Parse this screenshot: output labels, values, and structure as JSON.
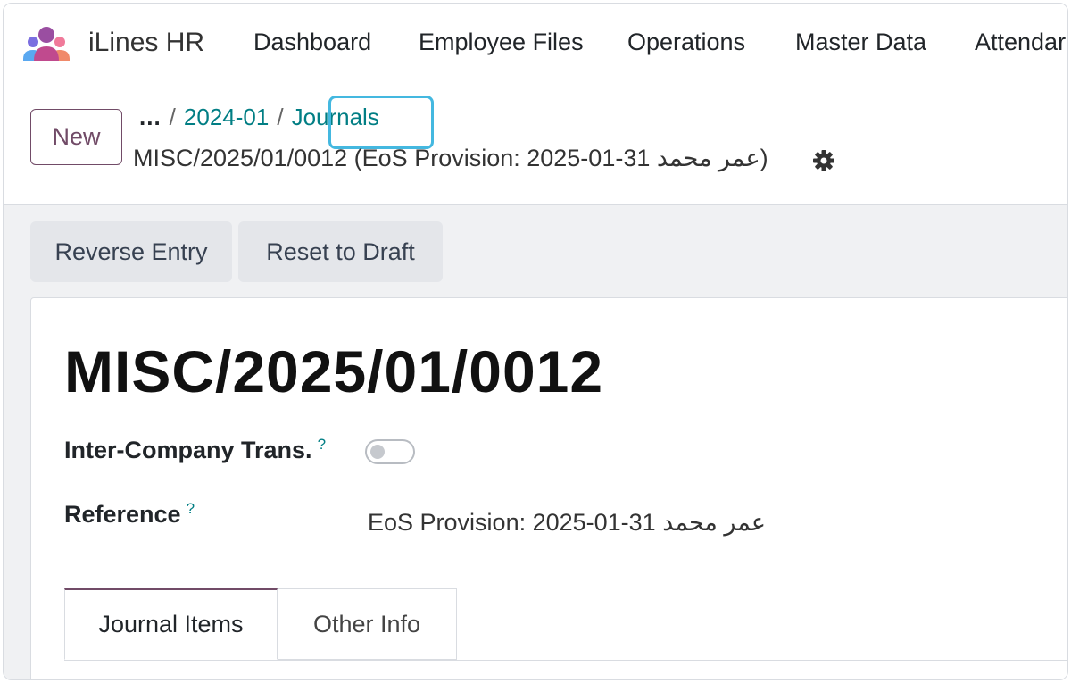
{
  "app": {
    "brand": "iLines HR",
    "logo_icon": "users-group-icon",
    "colors": {
      "brand": "#714b67",
      "link": "#017e84",
      "focus": "#44b8e0"
    }
  },
  "nav": {
    "items": [
      "Dashboard",
      "Employee Files",
      "Operations",
      "Master Data",
      "Attendar"
    ]
  },
  "control_panel": {
    "new_label": "New",
    "breadcrumb": {
      "ellipsis": "...",
      "separator": "/",
      "items": [
        "2024-01",
        "Journals"
      ]
    },
    "record_title": "MISC/2025/01/0012 (EoS Provision: 2025-01-31 عمر محمد)",
    "settings_icon": "gear-icon"
  },
  "actions": {
    "reverse_entry": "Reverse Entry",
    "reset_to_draft": "Reset to Draft"
  },
  "form": {
    "name": "MISC/2025/01/0012",
    "fields": {
      "inter_company": {
        "label": "Inter-Company Trans.",
        "help": "?",
        "value": false
      },
      "reference": {
        "label": "Reference",
        "help": "?",
        "value": "EoS Provision: 2025-01-31 عمر محمد"
      }
    },
    "tabs": [
      {
        "label": "Journal Items",
        "active": true
      },
      {
        "label": "Other Info",
        "active": false
      }
    ]
  }
}
